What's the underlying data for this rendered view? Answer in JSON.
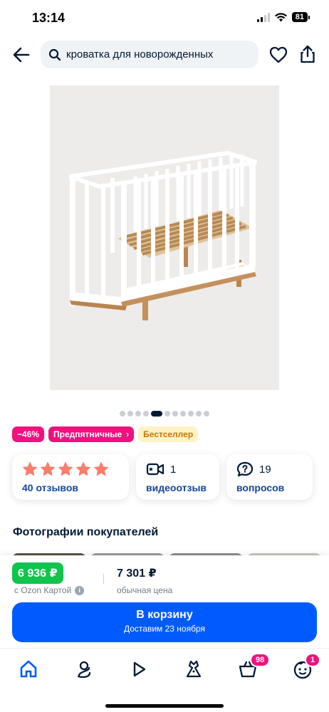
{
  "status": {
    "time": "13:14",
    "battery": "81"
  },
  "header": {
    "search_text": "кроватка для новорожденных"
  },
  "gallery": {
    "dot_count": 11,
    "active_index": 4
  },
  "badges": {
    "discount": "−46%",
    "friday": "Предпятничные",
    "bestseller": "Бестселлер"
  },
  "stats": {
    "rating_stars": 5,
    "reviews": "40 отзывов",
    "video_count": "1",
    "video_label": "видеоотзыв",
    "questions_count": "19",
    "questions_label": "вопросов"
  },
  "section": {
    "customer_photos": "Фотографии покупателей"
  },
  "price": {
    "ozon_price": "6 936 ₽",
    "ozon_caption": "с Ozon Картой",
    "regular_price": "7 301 ₽",
    "regular_caption": "обычная цена"
  },
  "cart": {
    "title": "В корзину",
    "delivery": "Доставим 23 ноября"
  },
  "tabbar": {
    "cart_badge": "98",
    "profile_badge": "1"
  },
  "colors": {
    "accent": "#005bff",
    "promo": "#f1117e",
    "green": "#10c44c",
    "star": "#f97d6c"
  }
}
